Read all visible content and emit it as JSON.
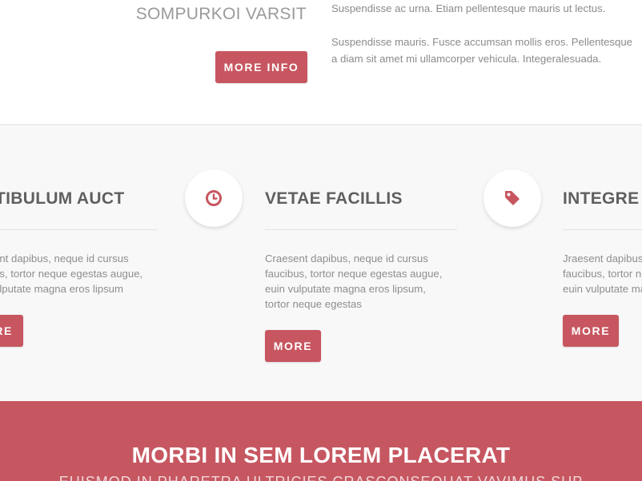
{
  "top_section": {
    "heading": "SOMPURKOI VARSIT",
    "button_label": "MORE INFO",
    "paragraph_1": "Suspendisse ac urna. Etiam pellentesque mauris ut lectus.",
    "paragraph_2_line_1": "Suspendisse mauris. Fusce accumsan mollis eros. Pellentesque",
    "paragraph_2_line_2": "a diam sit amet mi ullamcorper vehicula. Integeralesuada."
  },
  "features": [
    {
      "icon": "none",
      "title": "TIBULUM AUCT",
      "text_lines": [
        "ent dapibus, neque id cursus",
        "us, tortor neque egestas augue,",
        "ulputate magna eros lipsum"
      ],
      "button_label": "RE"
    },
    {
      "icon": "clock-icon",
      "title": "VETAE FACILLIS",
      "text_lines": [
        "Craesent dapibus, neque id cursus",
        "faucibus, tortor neque egestas augue,",
        "euin vulputate magna eros lipsum,",
        "tortor neque egestas"
      ],
      "button_label": "MORE"
    },
    {
      "icon": "tag-icon",
      "title": "INTEGRE I",
      "text_lines": [
        "Jraesent dapibus,",
        "faucibus, tortor n",
        "euin vulputate ma"
      ],
      "button_label": "MORE"
    }
  ],
  "banner": {
    "title": "MORBI IN SEM LOREM PLACERAT",
    "subtitle": "EUISMOD IN PHARETRA ULTRICIES CRASCONSEQUAT VAVIMUS SUP"
  },
  "colors": {
    "accent": "#c75660",
    "banner_background": "#c65761",
    "features_background": "#f8f8f8"
  }
}
